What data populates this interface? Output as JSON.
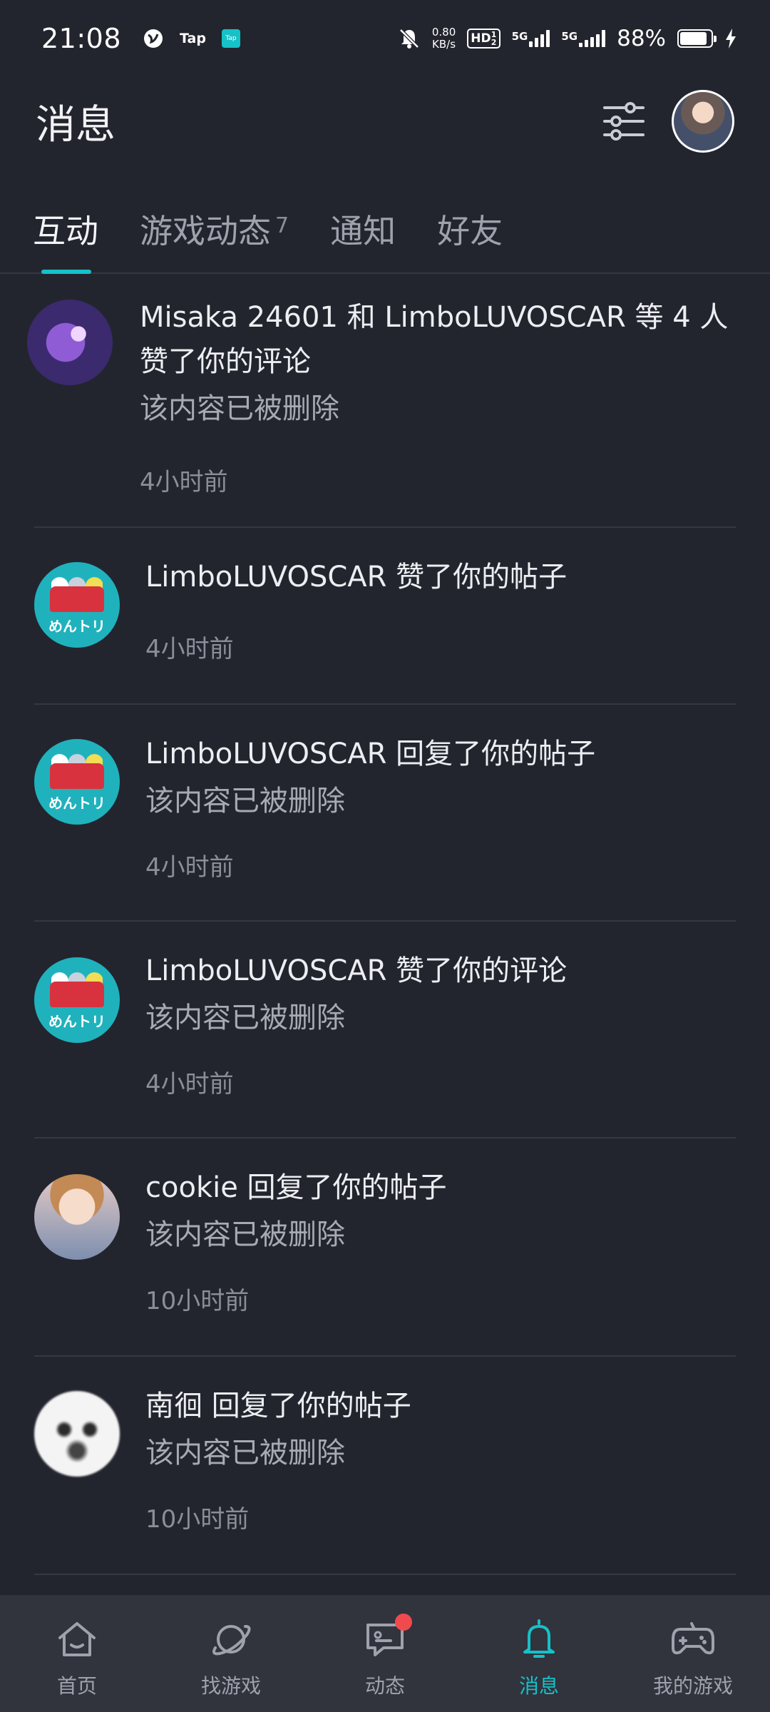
{
  "status_bar": {
    "time": "21:08",
    "tap_label": "Tap",
    "tap_badge": "Tap",
    "net_speed_value": "0.80",
    "net_speed_unit": "KB/s",
    "hd_label": "HD",
    "hd_sub": "1 2",
    "sig1_label": "5G",
    "sig2_label": "5G",
    "battery_percent": "88%",
    "battery_level": 0.88
  },
  "header": {
    "title": "消息"
  },
  "tabs": [
    {
      "label": "互动",
      "active": true
    },
    {
      "label": "游戏动态",
      "badge": "7"
    },
    {
      "label": "通知"
    },
    {
      "label": "好友"
    }
  ],
  "messages": [
    {
      "title": "Misaka 24601 和 LimboLUVOSCAR 等 4 人 赞了你的评论",
      "snippet": "该内容已被删除",
      "time": "4小时前"
    },
    {
      "title": "LimboLUVOSCAR 赞了你的帖子",
      "snippet": "",
      "time": "4小时前",
      "avatar_text": "めんトリ"
    },
    {
      "title": "LimboLUVOSCAR 回复了你的帖子",
      "snippet": "该内容已被删除",
      "time": "4小时前",
      "avatar_text": "めんトリ"
    },
    {
      "title": "LimboLUVOSCAR 赞了你的评论",
      "snippet": "该内容已被删除",
      "time": "4小时前",
      "avatar_text": "めんトリ"
    },
    {
      "title": "cookie 回复了你的帖子",
      "snippet": "该内容已被删除",
      "time": "10小时前"
    },
    {
      "title": "南徊 回复了你的帖子",
      "snippet": "该内容已被删除",
      "time": "10小时前"
    }
  ],
  "bottom_nav": [
    {
      "label": "首页",
      "icon": "home-icon"
    },
    {
      "label": "找游戏",
      "icon": "planet-icon"
    },
    {
      "label": "动态",
      "icon": "chat-icon",
      "has_dot": true
    },
    {
      "label": "消息",
      "icon": "bell-icon",
      "active": true
    },
    {
      "label": "我的游戏",
      "icon": "gamepad-icon"
    }
  ],
  "colors": {
    "background": "#23252e",
    "accent": "#16c1c8",
    "nav_background": "#31333d",
    "badge_red": "#f04a4f"
  }
}
